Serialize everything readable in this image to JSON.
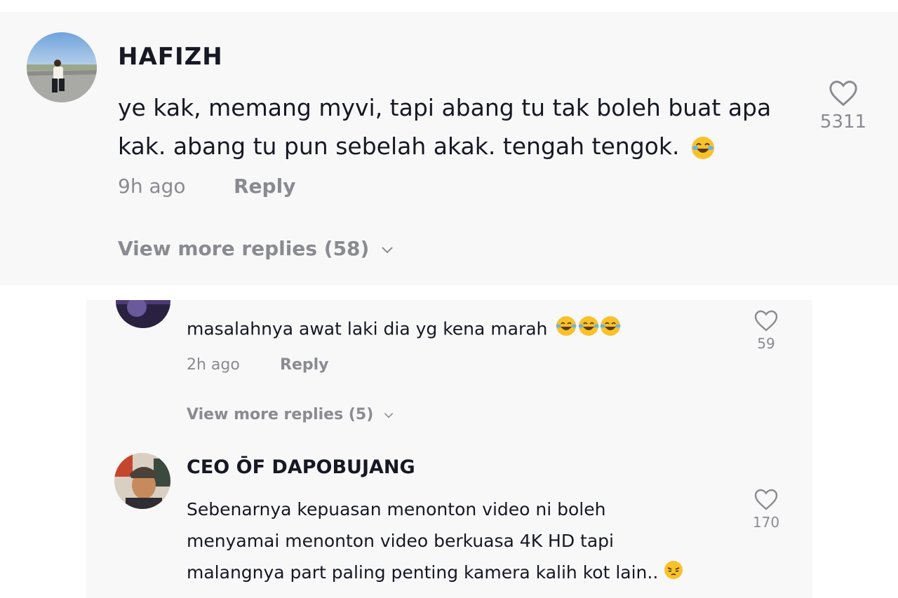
{
  "comments": [
    {
      "username": "HAFIZH",
      "text": "ye kak, memang myvi, tapi abang tu tak boleh buat apa kak. abang tu pun sebelah akak. tengah tengok.",
      "emoji": "face-with-tears-of-joy",
      "time": "9h ago",
      "reply_label": "Reply",
      "likes": "5311",
      "more_replies": "View more replies (58)",
      "avatar_icon": "profile-photo-person-on-road"
    },
    {
      "username": "",
      "text": "masalahnya awat laki dia yg kena marah",
      "emoji": "face-with-tears-of-joy x3",
      "time": "2h ago",
      "reply_label": "Reply",
      "likes": "59",
      "more_replies": "View more replies (5)",
      "avatar_icon": "profile-photo-purple"
    },
    {
      "username": "CEO ŌF DAPOBUJANG",
      "text_lines": [
        "Sebenarnya kepuasan menonton video ni boleh",
        "menyamai menonton video berkuasa 4K HD tapi",
        "malangnya part paling penting kamera kalih kot lain.."
      ],
      "emoji": "pensive-face",
      "likes": "170",
      "avatar_icon": "profile-photo-man-with-cap"
    }
  ],
  "colors": {
    "panel_bg": "#f8f8f8",
    "text_primary": "#161823",
    "text_secondary": "#8a8b91",
    "emoji_yellow": "#f9c12a"
  }
}
